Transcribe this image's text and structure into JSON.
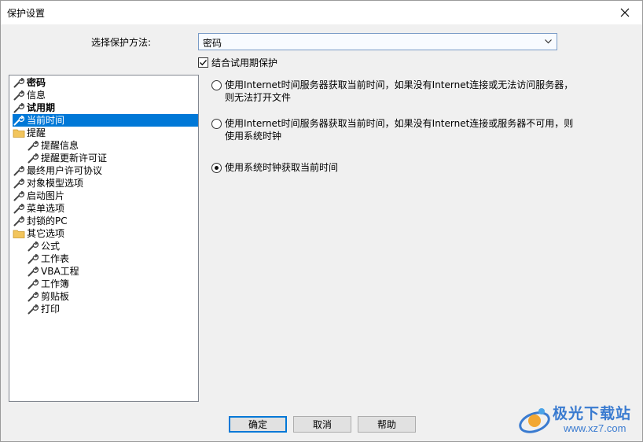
{
  "window": {
    "title": "保护设置"
  },
  "method": {
    "label": "选择保护方法:",
    "selected": "密码"
  },
  "trial_check": {
    "label": "结合试用期保护",
    "checked": true
  },
  "tree": {
    "items": [
      {
        "label": "密码",
        "icon": "wrench-icon",
        "level": 0,
        "bold": true
      },
      {
        "label": "信息",
        "icon": "wrench-icon",
        "level": 0
      },
      {
        "label": "试用期",
        "icon": "wrench-icon",
        "level": 0,
        "bold": true
      },
      {
        "label": "当前时间",
        "icon": "wrench-icon",
        "level": 0,
        "selected": true
      },
      {
        "label": "提醒",
        "icon": "folder-icon",
        "level": 0
      },
      {
        "label": "提醒信息",
        "icon": "wrench-icon",
        "level": 1
      },
      {
        "label": "提醒更新许可证",
        "icon": "wrench-icon",
        "level": 1
      },
      {
        "label": "最终用户许可协议",
        "icon": "wrench-icon",
        "level": 0
      },
      {
        "label": "对象模型选项",
        "icon": "wrench-icon",
        "level": 0
      },
      {
        "label": "启动图片",
        "icon": "wrench-icon",
        "level": 0
      },
      {
        "label": "菜单选项",
        "icon": "wrench-icon",
        "level": 0
      },
      {
        "label": "封锁的PC",
        "icon": "wrench-icon",
        "level": 0
      },
      {
        "label": "其它选项",
        "icon": "folder-icon",
        "level": 0
      },
      {
        "label": "公式",
        "icon": "wrench-icon",
        "level": 1
      },
      {
        "label": "工作表",
        "icon": "wrench-icon",
        "level": 1
      },
      {
        "label": "VBA工程",
        "icon": "wrench-icon",
        "level": 1
      },
      {
        "label": "工作簿",
        "icon": "wrench-icon",
        "level": 1
      },
      {
        "label": "剪贴板",
        "icon": "wrench-icon",
        "level": 1
      },
      {
        "label": "打印",
        "icon": "wrench-icon",
        "level": 1
      }
    ]
  },
  "options": [
    {
      "line1": "使用Internet时间服务器获取当前时间，如果没有Internet连接或无法访问服务器，",
      "line2": "则无法打开文件",
      "checked": false
    },
    {
      "line1": "使用Internet时间服务器获取当前时间，如果没有Internet连接或服务器不可用，则",
      "line2": "使用系统时钟",
      "checked": false
    },
    {
      "line1": "使用系统时钟获取当前时间",
      "line2": "",
      "checked": true
    }
  ],
  "buttons": {
    "ok": "确定",
    "cancel": "取消",
    "help": "帮助"
  },
  "watermark": {
    "title": "极光下载站",
    "url": "www.xz7.com"
  },
  "colors": {
    "selection": "#0078d7",
    "folder": "#f2c55c",
    "accent": "#3a7bd0"
  }
}
